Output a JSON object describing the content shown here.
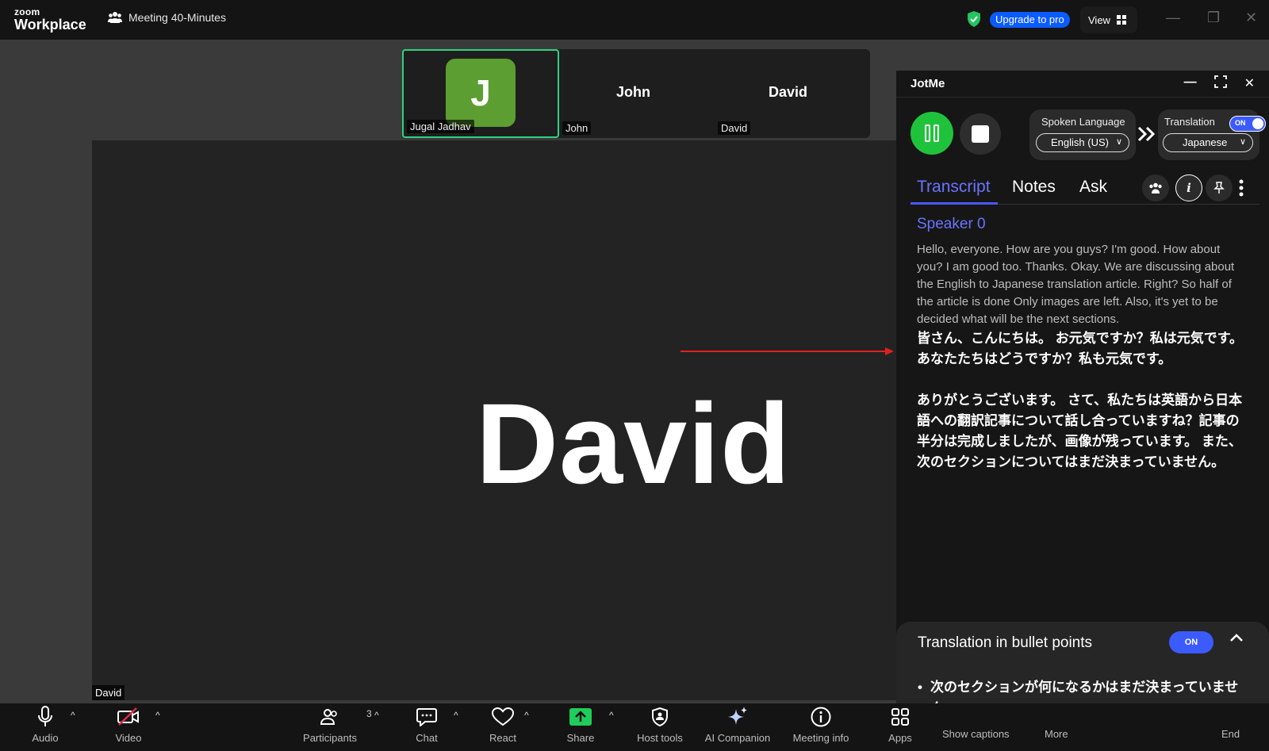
{
  "app": {
    "brand_small": "zoom",
    "brand_large": "Workplace",
    "meeting_title": "Meeting 40-Minutes"
  },
  "topbar": {
    "upgrade_label": "Upgrade to pro",
    "view_label": "View"
  },
  "thumbnails": [
    {
      "initial": "J",
      "tag": "Jugal Jadhav"
    },
    {
      "name": "John",
      "tag": "John"
    },
    {
      "name": "David",
      "tag": "David"
    }
  ],
  "main_video": {
    "speaker": "David",
    "tag": "David"
  },
  "jotme": {
    "title": "JotMe",
    "spoken_language": {
      "label": "Spoken Language",
      "value": "English (US)"
    },
    "translation": {
      "label": "Translation",
      "toggle": "ON",
      "value": "Japanese"
    },
    "tabs": {
      "transcript": "Transcript",
      "notes": "Notes",
      "ask": "Ask"
    },
    "transcript": {
      "speaker": "Speaker 0",
      "english": "Hello, everyone. How are you guys? I'm good. How about you? I am good too. Thanks. Okay. We are discussing about the English to Japanese translation article. Right? So half of the article is done Only images are left. Also, it's yet to be decided what will be the next sections.",
      "japanese_1": "皆さん、こんにちは。 お元気ですか？私は元気です。 あなたたちはどうですか？私も元気です。",
      "japanese_2": "ありがとうございます。 さて、私たちは英語から日本語への翻訳記事について話し合っていますね？記事の半分は完成しましたが、画像が残っています。 また、次のセクションについてはまだ決まっていません。"
    },
    "bullets": {
      "title": "Translation in bullet points",
      "toggle": "ON",
      "items": [
        "次のセクションが何になるかはまだ決まっていません。"
      ]
    }
  },
  "toolbar": {
    "audio": "Audio",
    "video": "Video",
    "participants": "Participants",
    "participants_count": "3",
    "chat": "Chat",
    "react": "React",
    "share": "Share",
    "host_tools": "Host tools",
    "ai_companion": "AI Companion",
    "meeting_info": "Meeting info",
    "apps": "Apps",
    "show_captions": "Show captions",
    "more": "More",
    "end": "End"
  },
  "colors": {
    "accent_green": "#2ed37d",
    "jotme_blue": "#4c56ff",
    "record_green": "#1fc33b",
    "upgrade_blue": "#0b5cff"
  }
}
